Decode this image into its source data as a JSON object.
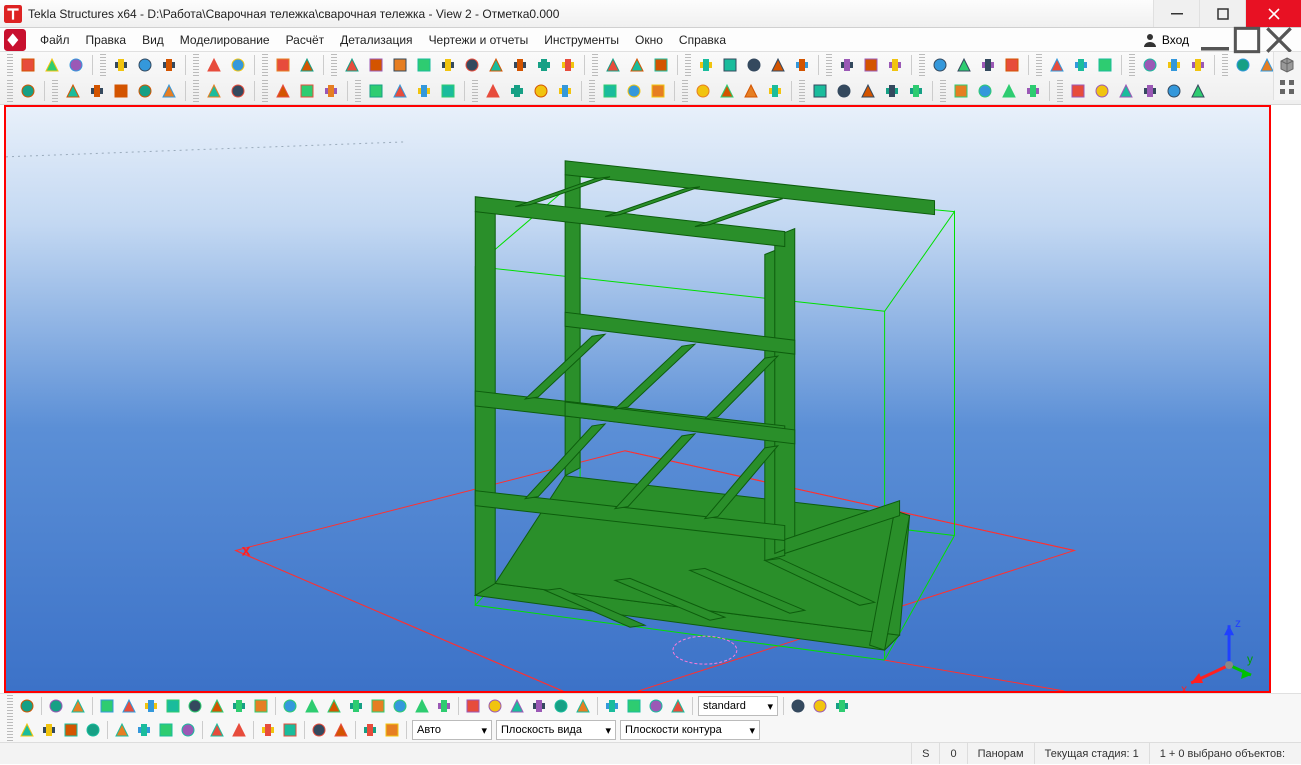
{
  "window": {
    "title": "Tekla Structures x64 - D:\\Работа\\Сварочная тележка\\сварочная тележка  - View 2 - Отметка0.000"
  },
  "menu": {
    "items": [
      "Файл",
      "Правка",
      "Вид",
      "Моделирование",
      "Расчёт",
      "Детализация",
      "Чертежи и отчеты",
      "Инструменты",
      "Окно",
      "Справка"
    ],
    "login": "Вход"
  },
  "toolbar_icons_row1": [
    "new",
    "open",
    "save",
    "share",
    "print",
    "properties",
    "layers",
    "catalog",
    "undo",
    "redo",
    "msquare",
    "marrow",
    "poly",
    "rect",
    "rects",
    "copy",
    "cut",
    "paste",
    "paste2",
    "potion",
    "brush",
    "shapes",
    "clip",
    "sel1",
    "sel2",
    "sel3",
    "sel4",
    "selall",
    "grid1",
    "grid2",
    "gridadd",
    "pt1",
    "pt2",
    "pt3",
    "pt4",
    "measure",
    "db1",
    "db2",
    "db3",
    "truck",
    "user",
    "tool1",
    "tool2"
  ],
  "toolbar_icons_row2": [
    "cube",
    "beam1",
    "beam2",
    "beam3",
    "beam4",
    "slab",
    "plate",
    "conn1",
    "conn2",
    "col",
    "pad",
    "strip",
    "s1",
    "s2",
    "s3",
    "arc",
    "curve",
    "spline",
    "cut1",
    "cut2",
    "dot",
    "ptline",
    "anchor",
    "star",
    "warn",
    "j1",
    "j2",
    "j3",
    "j4",
    "j5",
    "n1",
    "n2",
    "n3",
    "n4",
    "n5",
    "n6",
    "n7",
    "n8",
    "n9",
    "n10",
    "n11"
  ],
  "bottom_row1": {
    "icons": [
      "cursor",
      "tree",
      "add",
      "del",
      "b1",
      "b2",
      "b3",
      "b4",
      "b5",
      "b6",
      "b7",
      "b8",
      "b9",
      "b10",
      "b11",
      "b12",
      "b13",
      "b14",
      "b15",
      "b16",
      "b17",
      "b18",
      "b19",
      "b20",
      "b21",
      "b22",
      "b23",
      "b24",
      "b25"
    ],
    "combo1": "standard",
    "icons2": [
      "eye",
      "target",
      "lock"
    ]
  },
  "bottom_row2": {
    "icons": [
      "c1",
      "c2",
      "c3",
      "c4",
      "c5",
      "c6",
      "c7",
      "c8",
      "c9",
      "c10",
      "c11",
      "c12",
      "c13",
      "c14",
      "c15",
      "c16"
    ],
    "combo_auto": "Авто",
    "combo_plane": "Плоскость вида",
    "combo_contour": "Плоскости контура"
  },
  "status": {
    "s": "S",
    "zero": "0",
    "panorama": "Панорам",
    "stage": "Текущая стадия: 1",
    "selection": "1 + 0 выбрано объектов:"
  },
  "axis_labels": {
    "x": "x",
    "y": "y",
    "z": "z"
  },
  "colors": {
    "accent_red": "#ff0000",
    "steel_green": "#1e8b1e",
    "wire_green": "#00d000",
    "wire_red": "#ff2020"
  }
}
